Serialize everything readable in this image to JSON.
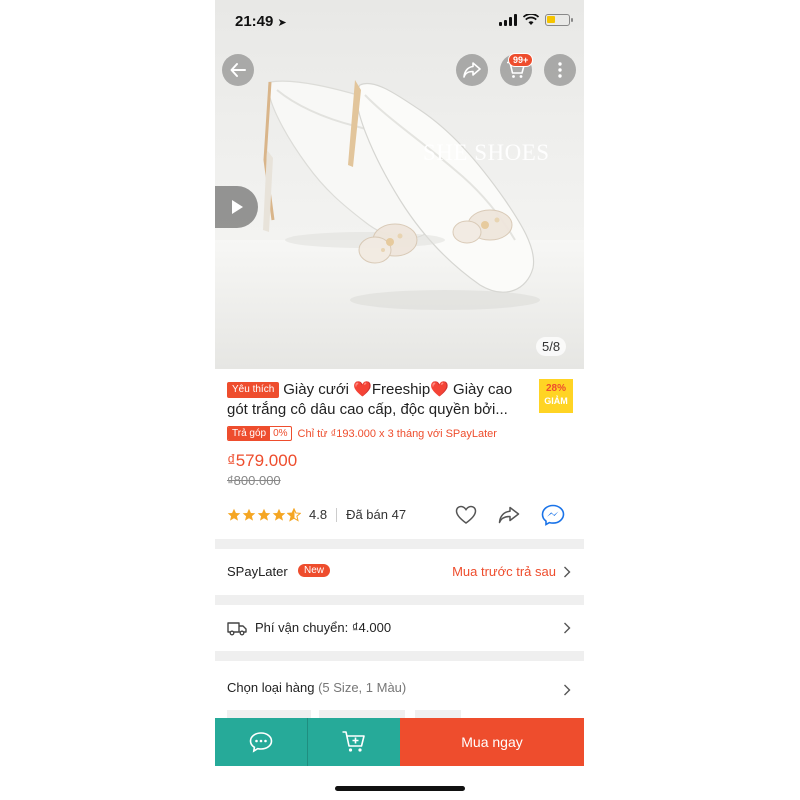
{
  "status_bar": {
    "time": "21:49",
    "location_arrow": "➤"
  },
  "header": {
    "back_icon": "arrow-left-icon",
    "share_icon": "share-icon",
    "cart_icon": "cart-icon",
    "cart_badge": "99+",
    "more_icon": "more-vertical-icon"
  },
  "gallery": {
    "watermark": "SHE SHOES",
    "counter": "5/8",
    "play_icon": "play-icon"
  },
  "product": {
    "badge": "Yêu thích",
    "title": "Giày cưới ❤️Freeship❤️ Giày cao gót trắng cô dâu cao cấp, độc quyền bởi...",
    "discount_pct": "28%",
    "discount_label": "GIẢM",
    "installment_tag": "Trả góp",
    "installment_rate": "0%",
    "installment_text": "Chỉ từ ₫193.000 x 3 tháng với SPayLater",
    "price": "₫579.000",
    "old_price": "₫800.000",
    "rating": "4.8",
    "rating_value": 4.8,
    "sold": "Đã bán 47"
  },
  "spaylater": {
    "label": "SPayLater",
    "new_badge": "New",
    "right_text": "Mua trước trả sau"
  },
  "shipping": {
    "label": "Phí vận chuyển: ₫4.000"
  },
  "variant": {
    "label": "Chọn loại hàng",
    "sub": "(5 Size, 1 Màu)"
  },
  "bottom_bar": {
    "buy_label": "Mua ngay"
  },
  "colors": {
    "brand": "#ee4d2d",
    "teal": "#26aa99",
    "star": "#f5a623"
  }
}
